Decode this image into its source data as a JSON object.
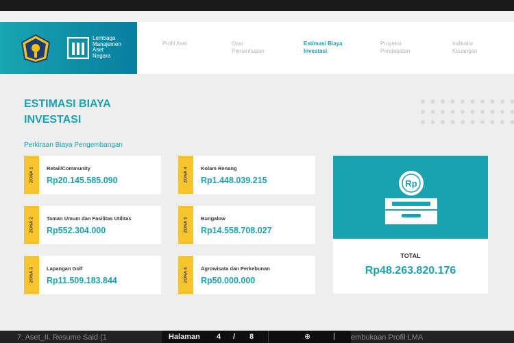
{
  "brand": {
    "logo_text": [
      "Lembaga",
      "Manajemen",
      "Aset",
      "Negara"
    ]
  },
  "nav": {
    "items": [
      {
        "label_1": "Profil Aset",
        "label_2": ""
      },
      {
        "label_1": "Opsi",
        "label_2": "Pemanfaatan"
      },
      {
        "label_1": "Estimasi Biaya",
        "label_2": "Investasi"
      },
      {
        "label_1": "Proyeksi",
        "label_2": "Pendapatan"
      },
      {
        "label_1": "Indikator",
        "label_2": "Keuangan"
      }
    ],
    "active_index": 2
  },
  "page": {
    "title_line1": "ESTIMASI BIAYA",
    "title_line2": "INVESTASI",
    "subtitle": "Perkiraan Biaya Pengembangan"
  },
  "zones": [
    {
      "zone": "ZONA 1",
      "label": "Retail/Community",
      "value": "Rp20.145.585.090"
    },
    {
      "zone": "ZONA 2",
      "label": "Taman Umum dan Fasilitas Utilitas",
      "value": "Rp552.304.000"
    },
    {
      "zone": "ZONA 3",
      "label": "Lapangan Golf",
      "value": "Rp11.509.183.844"
    },
    {
      "zone": "ZONA 4",
      "label": "Kolam Renang",
      "value": "Rp1.448.039.215"
    },
    {
      "zone": "ZONA 5",
      "label": "Bungalow",
      "value": "Rp14.558.708.027"
    },
    {
      "zone": "ZONA 6",
      "label": "Agrowisata dan Perkebunan",
      "value": "Rp50.000.000"
    }
  ],
  "total": {
    "label": "TOTAL",
    "value": "Rp48.263.820.176",
    "icon_text": "Rp"
  },
  "bottom_bar": {
    "left_text": "7. Aset_II. Resume Said (1",
    "right_text": "embukaan Profil LMA",
    "pager_label": "Halaman",
    "current_page": "4",
    "separator": "/",
    "total_pages": "8"
  },
  "colors": {
    "accent": "#19a3b0",
    "zone_tag": "#f7c52b",
    "background": "#eeeeee"
  }
}
